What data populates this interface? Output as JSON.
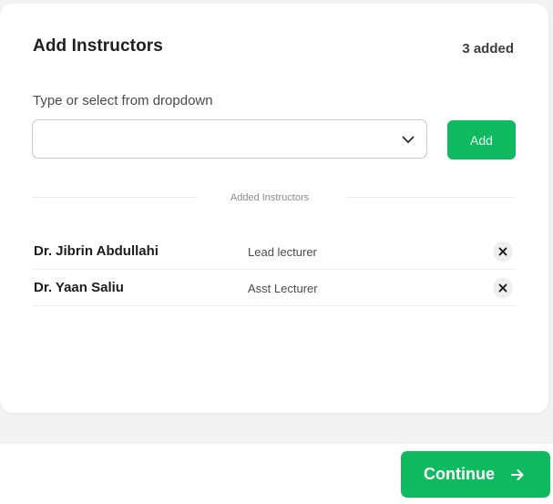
{
  "dialog": {
    "title": "Add Instructors",
    "count_label": "3 added"
  },
  "form": {
    "field_label": "Type or select from dropdown",
    "input_value": "",
    "input_placeholder": "",
    "dropdown_icon": "chevron-down-icon",
    "add_label": "Add"
  },
  "section": {
    "divider_label": "Added Instructors"
  },
  "instructors": [
    {
      "name": "Dr. Jibrin Abdullahi",
      "role": "Lead lecturer",
      "remove_icon": "close-icon"
    },
    {
      "name": "Dr. Yaan Saliu",
      "role": "Asst Lecturer",
      "remove_icon": "close-icon"
    }
  ],
  "footer": {
    "continue_label": "Continue",
    "continue_icon": "arrow-right-icon"
  },
  "colors": {
    "accent": "#0fba61",
    "background": "#f3f3f3",
    "card": "#ffffff"
  }
}
